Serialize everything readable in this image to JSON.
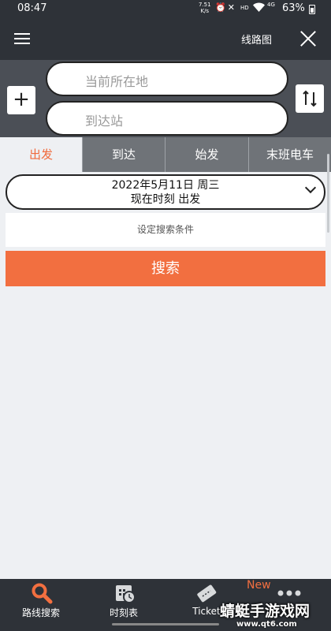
{
  "status": {
    "time": "08:47",
    "speed_value": "7.51",
    "speed_unit": "K/s",
    "hd": "HD",
    "network": "4G",
    "battery": "63%"
  },
  "appbar": {
    "route_map_label": "线路图"
  },
  "search": {
    "from_placeholder": "当前所在地",
    "to_placeholder": "到达站"
  },
  "tabs": [
    {
      "label": "出发",
      "active": true
    },
    {
      "label": "到达",
      "active": false
    },
    {
      "label": "始发",
      "active": false
    },
    {
      "label": "末班电车",
      "active": false
    }
  ],
  "date": {
    "line1": "2022年5月11日 周三",
    "line2": "现在时刻 出发"
  },
  "conditions_label": "设定搜索条件",
  "search_button_label": "搜索",
  "bottom_nav": {
    "items": [
      {
        "label": "路线搜索",
        "icon": "search-icon"
      },
      {
        "label": "时刻表",
        "icon": "timetable-clock-icon"
      },
      {
        "label": "Ticket",
        "icon": "ticket-icon"
      },
      {
        "label": "",
        "icon": "more-dots-icon"
      }
    ],
    "new_badge": "New"
  },
  "watermark": {
    "text": "蜻蜓手游戏网",
    "url": "www.qt6.com"
  },
  "colors": {
    "accent": "#f26f40",
    "dark_bar": "#2e3238",
    "panel": "#4b4f56",
    "tab_inactive": "#6f7378",
    "background": "#eef0f3"
  }
}
